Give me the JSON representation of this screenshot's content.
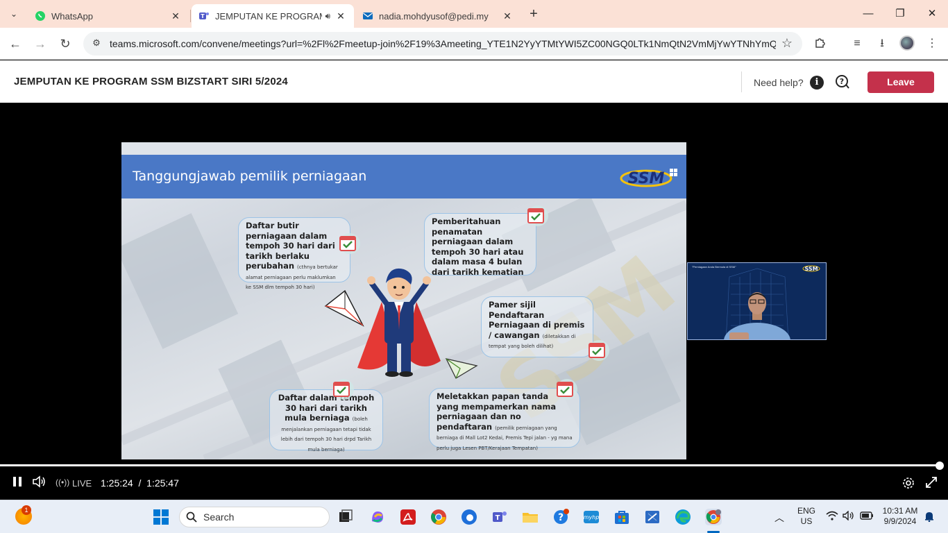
{
  "browser": {
    "tabs": [
      {
        "label": "WhatsApp",
        "icon": "whatsapp-icon",
        "active": false
      },
      {
        "label": "JEMPUTAN KE PROGRAM S",
        "icon": "teams-icon",
        "active": true
      },
      {
        "label": "nadia.mohdyusof@pedi.my",
        "icon": "outlook-icon",
        "active": false
      }
    ],
    "url": "teams.microsoft.com/convene/meetings?url=%2Fl%2Fmeetup-join%2F19%3Ameeting_YTE1N2YyYTMtYWI5ZC00NGQ0LTk1NmQtN2VmMjYwYTNhYmQ..."
  },
  "teams": {
    "meeting_title": "JEMPUTAN KE PROGRAM SSM BIZSTART SIRI 5/2024",
    "need_help": "Need help?",
    "leave_label": "Leave"
  },
  "slide": {
    "title": "Tanggungjawab pemilik perniagaan",
    "logo_text": "SSM",
    "bubble1_main": "Daftar butir perniagaan dalam tempoh 30 hari dari tarikh berlaku perubahan",
    "bubble1_small": "(cthnya bertukar alamat perniagaan perlu maklumkan ke SSM dlm tempoh 30 hari)",
    "bubble2_main": "Pemberitahuan penamatan perniagaan dalam tempoh 30 hari atau dalam masa 4 bulan dari tarikh kematian",
    "bubble3_main": "Pamer sijil Pendaftaran Perniagaan di premis / cawangan",
    "bubble3_small": "(diletakkan di tempat yang boleh dilihat)",
    "bubble4_main": "Daftar dalam tempoh 30 hari dari tarikh mula berniaga",
    "bubble4_small": "(boleh menjalankan perniagaan tetapi tidak lebih dari tempoh 30 hari drpd Tarikh mula berniaga)",
    "bubble5_main": "Meletakkan papan tanda yang mempamerkan nama perniagaan dan no pendaftaran",
    "bubble5_small": "(pemilik perniagaan yang berniaga di Mall Lot2 Kedai, Premis Tepi jalan - yg mana perlu juga Lesen PBT/Kerajaan Tempatan)"
  },
  "pip": {
    "banner_text": "\"Perniagaan Anda Bermula di SSM\"",
    "logo_text": "SSM"
  },
  "player": {
    "live_label": "LIVE",
    "current_time": "1:25:24",
    "separator": "/",
    "duration": "1:25:47",
    "progress_fraction": 0.9955
  },
  "taskbar": {
    "search_placeholder": "Search",
    "weather_badge": "1",
    "lang_line1": "ENG",
    "lang_line2": "US",
    "time": "10:31 AM",
    "date": "9/9/2024"
  }
}
